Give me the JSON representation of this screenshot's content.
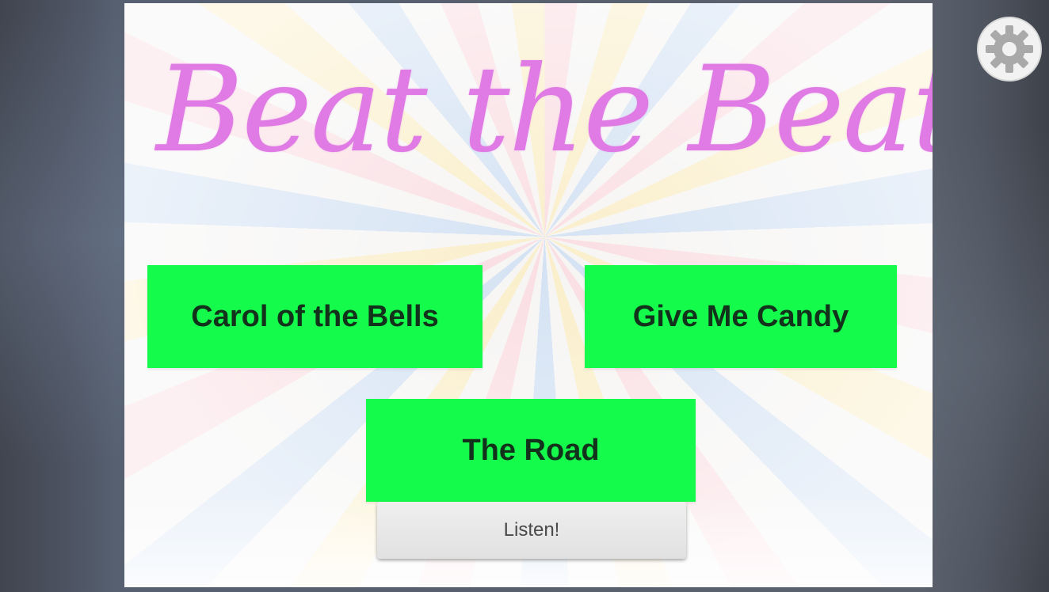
{
  "app": {
    "title": "Beat the Beat"
  },
  "songs": [
    {
      "label": "Carol of the Bells"
    },
    {
      "label": "Give Me Candy"
    },
    {
      "label": "The Road"
    }
  ],
  "actions": {
    "listen_label": "Listen!"
  },
  "toolbar": {
    "settings_icon": "gear-icon"
  },
  "colors": {
    "title": "#e07ae4",
    "song_button": "#14fb4c",
    "song_text": "#12321b"
  }
}
